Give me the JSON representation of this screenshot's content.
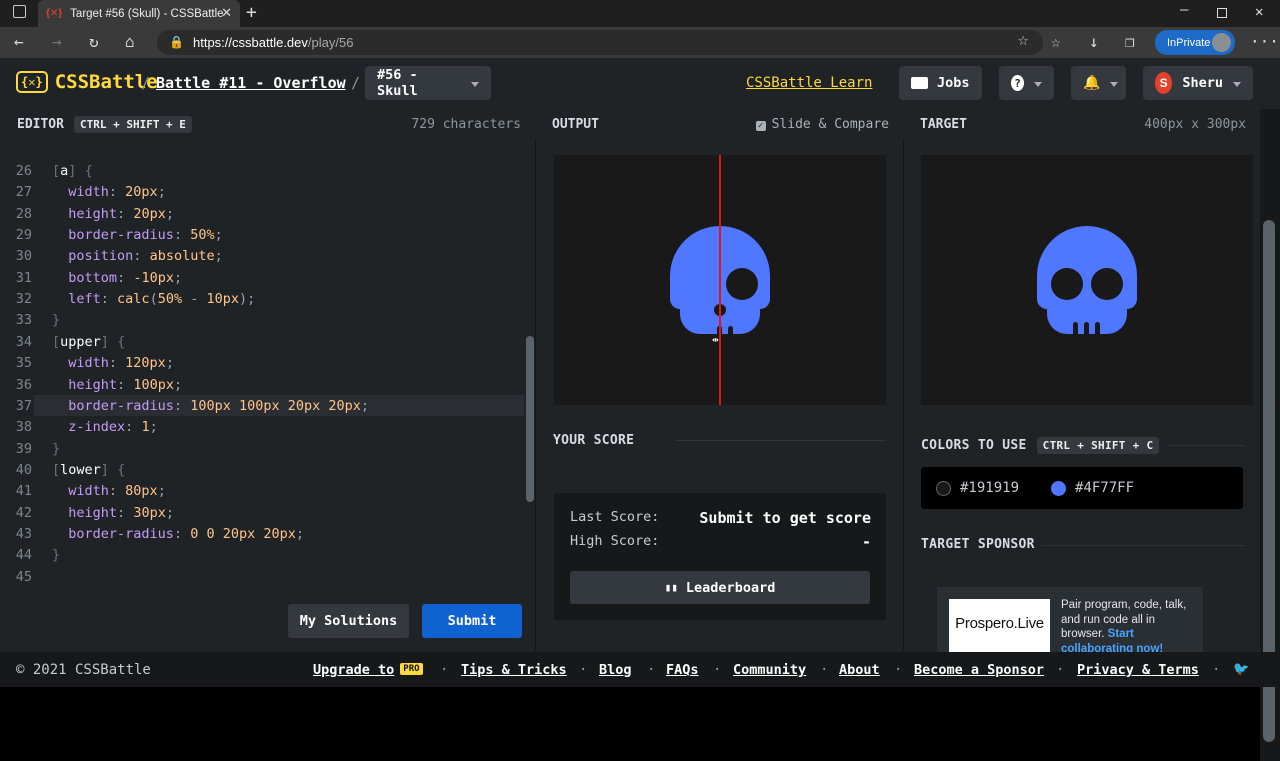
{
  "browser": {
    "tab_title": "Target #56 (Skull) - CSSBattle",
    "url_host": "https://cssbattle.dev",
    "url_path": "/play/56",
    "inprivate": "InPrivate"
  },
  "header": {
    "logo": "CSSBattle",
    "logo_mark": "{✕}",
    "battle": "Battle #11 - Overflow",
    "target": "#56 - Skull",
    "learn": "CSSBattle Learn",
    "jobs": "Jobs",
    "help": "?",
    "user": "Sheru",
    "user_initial": "S"
  },
  "editor": {
    "title": "EDITOR",
    "shortcut": "CTRL + SHIFT + E",
    "characters": "729 characters",
    "lines": [
      {
        "n": "26",
        "html": "<span class='br'>[</span><span class='sel'>a</span><span class='br'>]</span> <span class='br'>{</span>"
      },
      {
        "n": "27",
        "html": "  <span class='prop'>width</span>: <span class='val'>20px</span>;"
      },
      {
        "n": "28",
        "html": "  <span class='prop'>height</span>: <span class='val'>20px</span>;"
      },
      {
        "n": "29",
        "html": "  <span class='prop'>border-radius</span>: <span class='val'>50%</span>;"
      },
      {
        "n": "30",
        "html": "  <span class='prop'>position</span>: <span class='val'>absolute</span>;"
      },
      {
        "n": "31",
        "html": "  <span class='prop'>bottom</span>: <span class='val'>-10px</span>;"
      },
      {
        "n": "32",
        "html": "  <span class='prop'>left</span>: <span class='val'>calc</span>(<span class='val'>50%</span> - <span class='val'>10px</span>);"
      },
      {
        "n": "33",
        "html": "<span class='br'>}</span>"
      },
      {
        "n": "34",
        "html": "<span class='br'>[</span><span class='sel'>upper</span><span class='br'>]</span> <span class='br'>{</span>"
      },
      {
        "n": "35",
        "html": "  <span class='prop'>width</span>: <span class='val'>120px</span>;"
      },
      {
        "n": "36",
        "html": "  <span class='prop'>height</span>: <span class='val'>100px</span>;"
      },
      {
        "n": "37",
        "html": "  <span class='prop'>border-radius</span>: <span class='val'>100px 100px 20px 20px</span>;"
      },
      {
        "n": "38",
        "html": "  <span class='prop'>z-index</span>: <span class='val'>1</span>;"
      },
      {
        "n": "39",
        "html": "<span class='br'>}</span>"
      },
      {
        "n": "40",
        "html": "<span class='br'>[</span><span class='sel'>lower</span><span class='br'>]</span> <span class='br'>{</span>"
      },
      {
        "n": "41",
        "html": "  <span class='prop'>width</span>: <span class='val'>80px</span>;"
      },
      {
        "n": "42",
        "html": "  <span class='prop'>height</span>: <span class='val'>30px</span>;"
      },
      {
        "n": "43",
        "html": "  <span class='prop'>border-radius</span>: <span class='val'>0 0 20px 20px</span>;"
      },
      {
        "n": "44",
        "html": "<span class='br'>}</span>"
      },
      {
        "n": "45",
        "html": ""
      }
    ],
    "my_solutions": "My Solutions",
    "submit": "Submit"
  },
  "output": {
    "title": "OUTPUT",
    "slide_compare": "Slide & Compare",
    "score_title": "YOUR SCORE",
    "last_score_label": "Last Score:",
    "last_score_value": "Submit to get score",
    "high_score_label": "High Score:",
    "high_score_value": "-",
    "leaderboard": "Leaderboard"
  },
  "target": {
    "title": "TARGET",
    "size": "400px x 300px",
    "colors_title": "COLORS TO USE",
    "colors_shortcut": "CTRL + SHIFT + C",
    "colors": [
      {
        "hex": "#191919"
      },
      {
        "hex": "#4F77FF"
      }
    ],
    "sponsor_title": "TARGET SPONSOR",
    "sponsor_logo": "Prospero.Live",
    "sponsor_text": "Pair program, code, talk, and run code all in browser.",
    "sponsor_link": "Start collaborating now!"
  },
  "footer": {
    "copyright": "© 2021 CSSBattle",
    "links": [
      "Upgrade to",
      "Tips & Tricks",
      "Blog",
      "FAQs",
      "Community",
      "About",
      "Become a Sponsor",
      "Privacy & Terms"
    ],
    "pro_badge": "PRO"
  },
  "theme": {
    "accent": "#ffd93d",
    "blue": "#4F77FF",
    "bg": "#191919",
    "submit": "#0f62d0"
  }
}
